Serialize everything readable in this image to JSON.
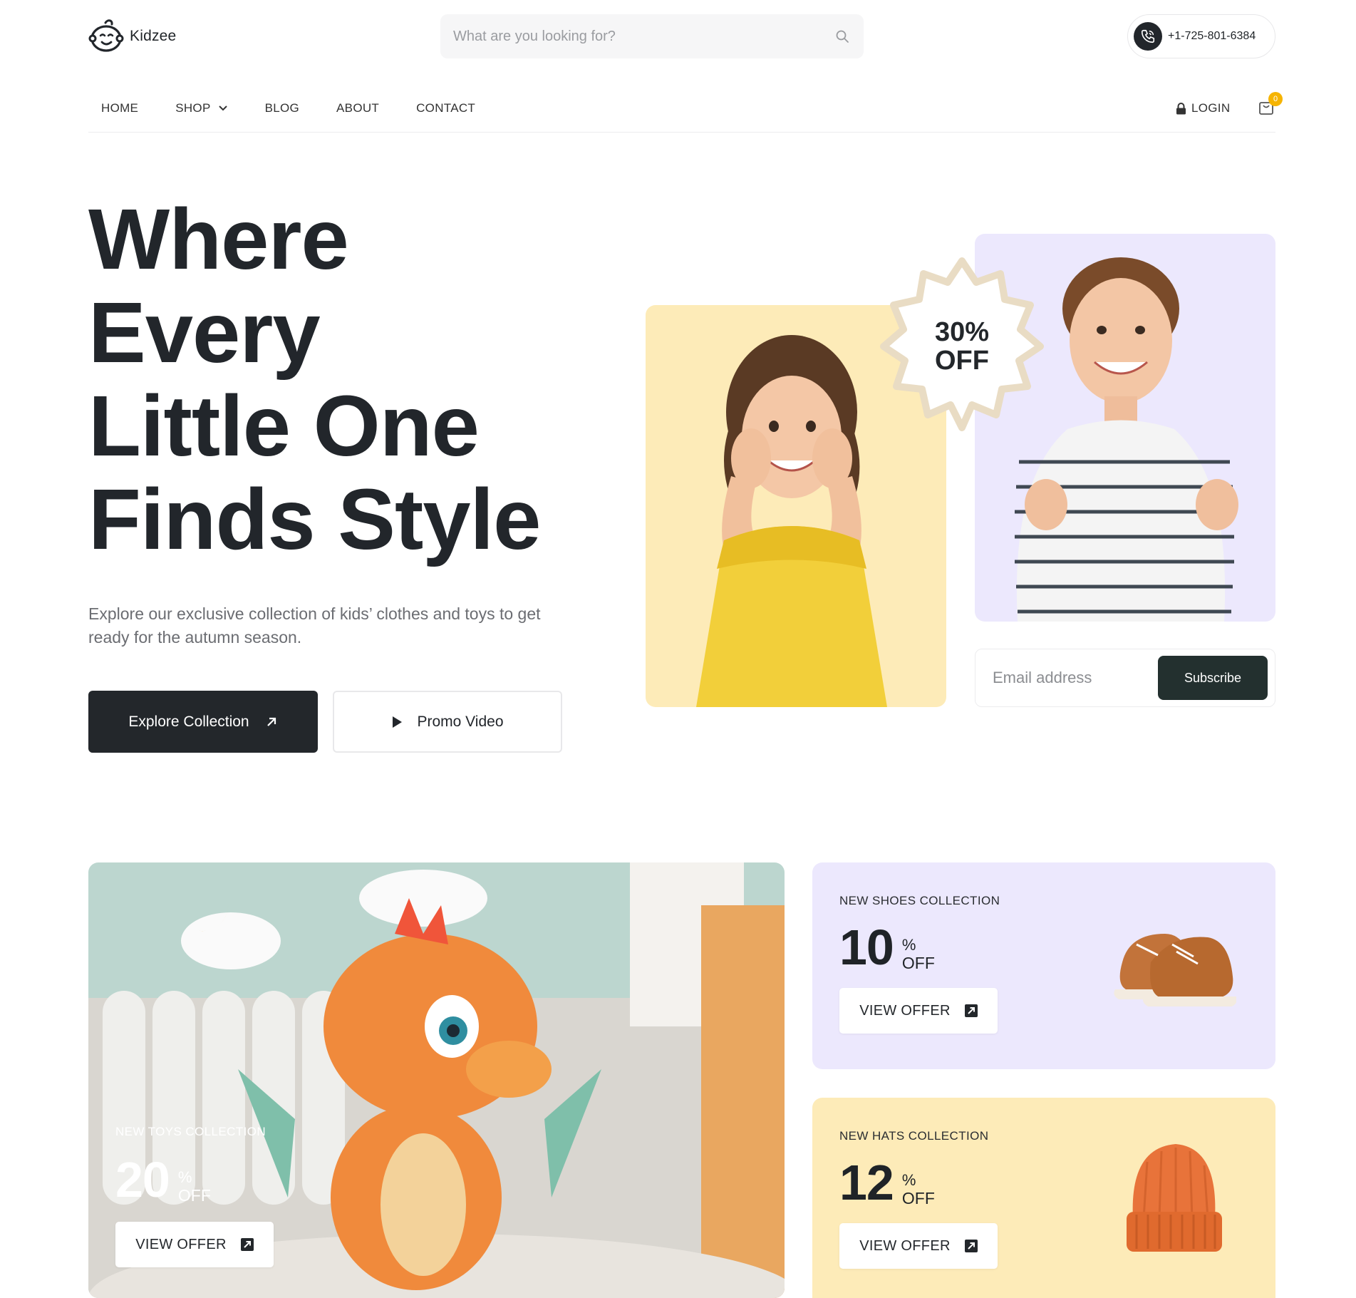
{
  "brand": {
    "name": "Kidzee"
  },
  "search": {
    "placeholder": "What are you looking for?"
  },
  "contact": {
    "phone": "+1-725-801-6384"
  },
  "nav": {
    "items": [
      "HOME",
      "SHOP",
      "BLOG",
      "ABOUT",
      "CONTACT"
    ],
    "login": "LOGIN",
    "cart_count": "0"
  },
  "hero": {
    "title_lines": [
      "Where",
      "Every",
      "Little One",
      "Finds Style"
    ],
    "description": "Explore our exclusive collection of kids’ clothes and toys to get ready for the autumn season.",
    "explore_button": "Explore Collection",
    "promo_button": "Promo Video",
    "discount_value": "30%",
    "discount_word": "OFF",
    "email_placeholder": "Email address",
    "subscribe_button": "Subscribe"
  },
  "collections": [
    {
      "label": "NEW TOYS COLLECTION",
      "value": "20",
      "percent": "%",
      "off": "OFF",
      "button": "VIEW OFFER"
    },
    {
      "label": "NEW SHOES COLLECTION",
      "value": "10",
      "percent": "%",
      "off": "OFF",
      "button": "VIEW OFFER"
    },
    {
      "label": "NEW HATS COLLECTION",
      "value": "12",
      "percent": "%",
      "off": "OFF",
      "button": "VIEW OFFER"
    }
  ],
  "colors": {
    "dark": "#23272b",
    "yellow_card": "#fdebb8",
    "purple_card": "#ece8fd",
    "badge": "#f6b400"
  }
}
